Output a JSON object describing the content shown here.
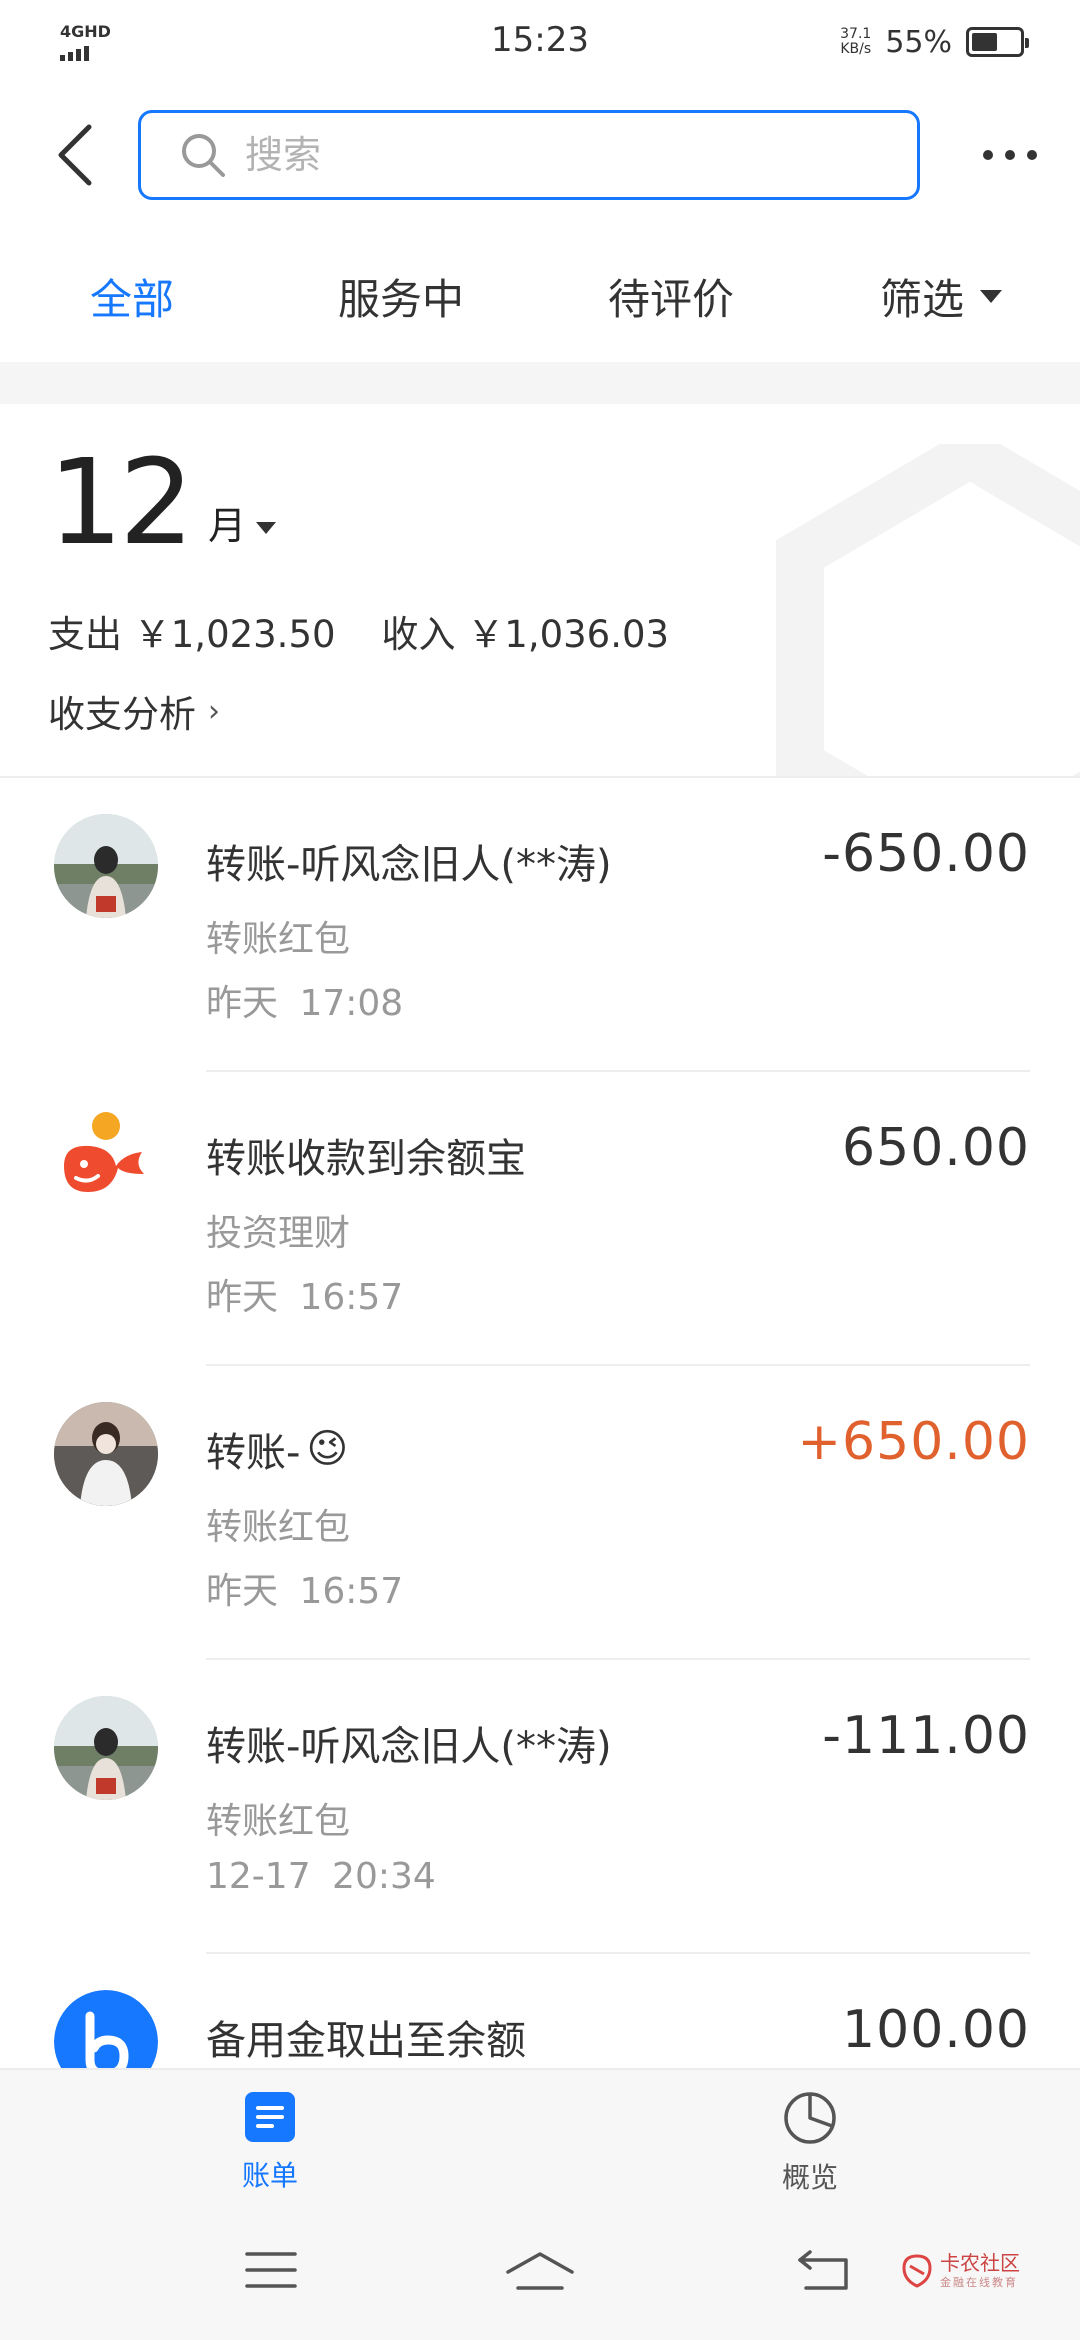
{
  "status_bar": {
    "network": "4GHD",
    "time": "15:23",
    "speed_value": "37.1",
    "speed_unit": "KB/s",
    "battery": "55%",
    "battery_level": 0.55
  },
  "header": {
    "search_placeholder": "搜索"
  },
  "tabs": [
    {
      "label": "全部",
      "active": true
    },
    {
      "label": "服务中",
      "active": false
    },
    {
      "label": "待评价",
      "active": false
    },
    {
      "label": "筛选",
      "active": false
    }
  ],
  "summary": {
    "month": "12",
    "month_unit": "月",
    "expense": "支出 ￥1,023.50",
    "income": "收入 ￥1,036.03",
    "analysis": "收支分析",
    "analysis_chevron": "›"
  },
  "transactions": [
    {
      "title": "转账-听风念旧人(**涛)",
      "category": "转账红包",
      "time": "昨天 17:08",
      "amount": "-650.00",
      "type": "expense",
      "avatar": "photo-avatar-1"
    },
    {
      "title": "转账收款到余额宝",
      "category": "投资理财",
      "time": "昨天 16:57",
      "amount": "650.00",
      "type": "neutral",
      "avatar": "yuebao-logo"
    },
    {
      "title": "转账-",
      "emoji": "😉",
      "category": "转账红包",
      "time": "昨天 16:57",
      "amount": "+650.00",
      "type": "income",
      "avatar": "photo-avatar-2"
    },
    {
      "title": "转账-听风念旧人(**涛)",
      "category": "转账红包",
      "time": "12-17 20:34",
      "amount": "-111.00",
      "type": "expense",
      "avatar": "photo-avatar-1"
    },
    {
      "title": "备用金取出至余额",
      "category": "",
      "time": "",
      "amount": "100.00",
      "type": "neutral",
      "avatar": "beiyongjin-logo"
    }
  ],
  "bottom_tabs": [
    {
      "label": "账单",
      "icon": "bill-icon",
      "active": true
    },
    {
      "label": "概览",
      "icon": "pie-chart-icon",
      "active": false
    }
  ],
  "watermark": {
    "brand": "卡农社区",
    "sub": "金融在线教育"
  },
  "colors": {
    "accent": "#1677ff",
    "income": "#e0612e",
    "secondary_text": "#999999"
  }
}
